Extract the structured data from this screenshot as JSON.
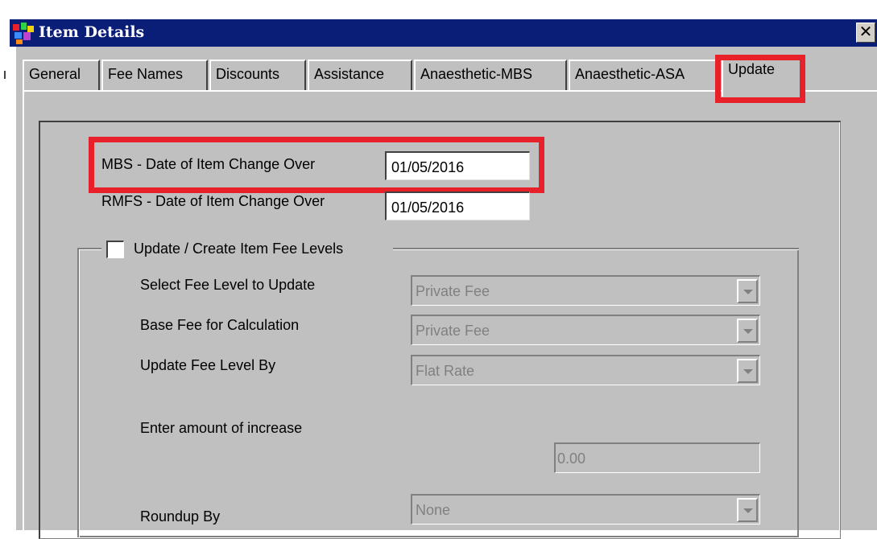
{
  "window": {
    "title": "Item Details",
    "close_glyph": "✕",
    "icon": "app-icon",
    "colors": {
      "titlebar": "#0a1e78",
      "face": "#c0c0c0",
      "highlight_box": "#e8202a"
    }
  },
  "tabs": [
    {
      "label": "General"
    },
    {
      "label": "Fee Names"
    },
    {
      "label": "Discounts"
    },
    {
      "label": "Assistance"
    },
    {
      "label": "Anaesthetic-MBS"
    },
    {
      "label": "Anaesthetic-ASA"
    },
    {
      "label": "Update",
      "active": true
    }
  ],
  "dates": {
    "mbs_label": "MBS - Date of Item Change Over",
    "mbs_value": "01/05/2016",
    "rmfs_label": "RMFS - Date of Item Change Over",
    "rmfs_value": "01/05/2016"
  },
  "fee_levels": {
    "checkbox_label": "Update / Create Item Fee Levels",
    "checked": false,
    "select_label": "Select Fee Level to Update",
    "select_value": "Private Fee",
    "base_label": "Base Fee for Calculation",
    "base_value": "Private Fee",
    "update_by_label": "Update Fee Level By",
    "update_by_value": "Flat Rate",
    "amount_label": "Enter amount of increase",
    "amount_value": "0.00",
    "roundup_label": "Roundup By",
    "roundup_value": "None"
  }
}
